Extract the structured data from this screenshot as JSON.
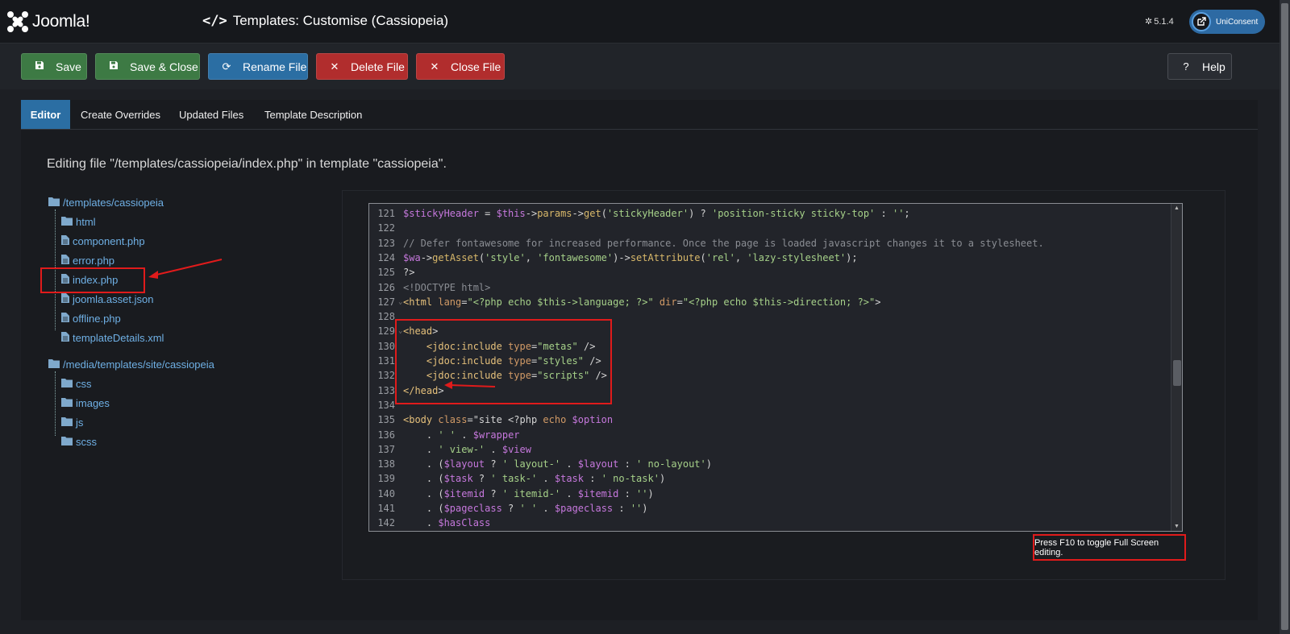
{
  "header": {
    "logo_text": "Joomla!",
    "title": "Templates: Customise (Cassiopeia)",
    "version": "5.1.4",
    "user_label": "UniConsent"
  },
  "toolbar": {
    "save": "Save",
    "save_close": "Save & Close",
    "rename": "Rename File",
    "delete": "Delete File",
    "close": "Close File",
    "help": "Help"
  },
  "tabs": [
    "Editor",
    "Create Overrides",
    "Updated Files",
    "Template Description"
  ],
  "editing_message": "Editing file \"/templates/cassiopeia/index.php\" in template \"cassiopeia\".",
  "tree": {
    "root1": "/templates/cassiopeia",
    "root1_items": [
      "html",
      "component.php",
      "error.php",
      "index.php",
      "joomla.asset.json",
      "offline.php",
      "templateDetails.xml"
    ],
    "root2": "/media/templates/site/cassiopeia",
    "root2_items": [
      "css",
      "images",
      "js",
      "scss"
    ]
  },
  "code": {
    "line_numbers": [
      "121",
      "122",
      "123",
      "124",
      "125",
      "126",
      "127",
      "128",
      "129",
      "130",
      "131",
      "132",
      "133",
      "134",
      "135",
      "136",
      "137",
      "138",
      "139",
      "140",
      "141",
      "142"
    ],
    "lines": [
      "$stickyHeader = $this->params->get('stickyHeader') ? 'position-sticky sticky-top' : '';",
      "",
      "// Defer fontawesome for increased performance. Once the page is loaded javascript changes it to a stylesheet.",
      "$wa->getAsset('style', 'fontawesome')->setAttribute('rel', 'lazy-stylesheet');",
      "?>",
      "<!DOCTYPE html>",
      "<html lang=\"<?php echo $this->language; ?>\" dir=\"<?php echo $this->direction; ?>\">",
      "",
      "<head>",
      "    <jdoc:include type=\"metas\" />",
      "    <jdoc:include type=\"styles\" />",
      "    <jdoc:include type=\"scripts\" />",
      "</head>",
      "",
      "<body class=\"site <?php echo $option",
      "    . ' ' . $wrapper",
      "    . ' view-' . $view",
      "    . ($layout ? ' layout-' . $layout : ' no-layout')",
      "    . ($task ? ' task-' . $task : ' no-task')",
      "    . ($itemid ? ' itemid-' . $itemid : '')",
      "    . ($pageclass ? ' ' . $pageclass : '')",
      "    . $hasClass"
    ]
  },
  "f10_note": "Press F10 to toggle Full Screen editing.",
  "colors": {
    "accent_blue": "#2b6ea3",
    "save_green": "#3d7a44",
    "danger_red": "#b12d2d",
    "annotation_red": "#e01b1b"
  }
}
